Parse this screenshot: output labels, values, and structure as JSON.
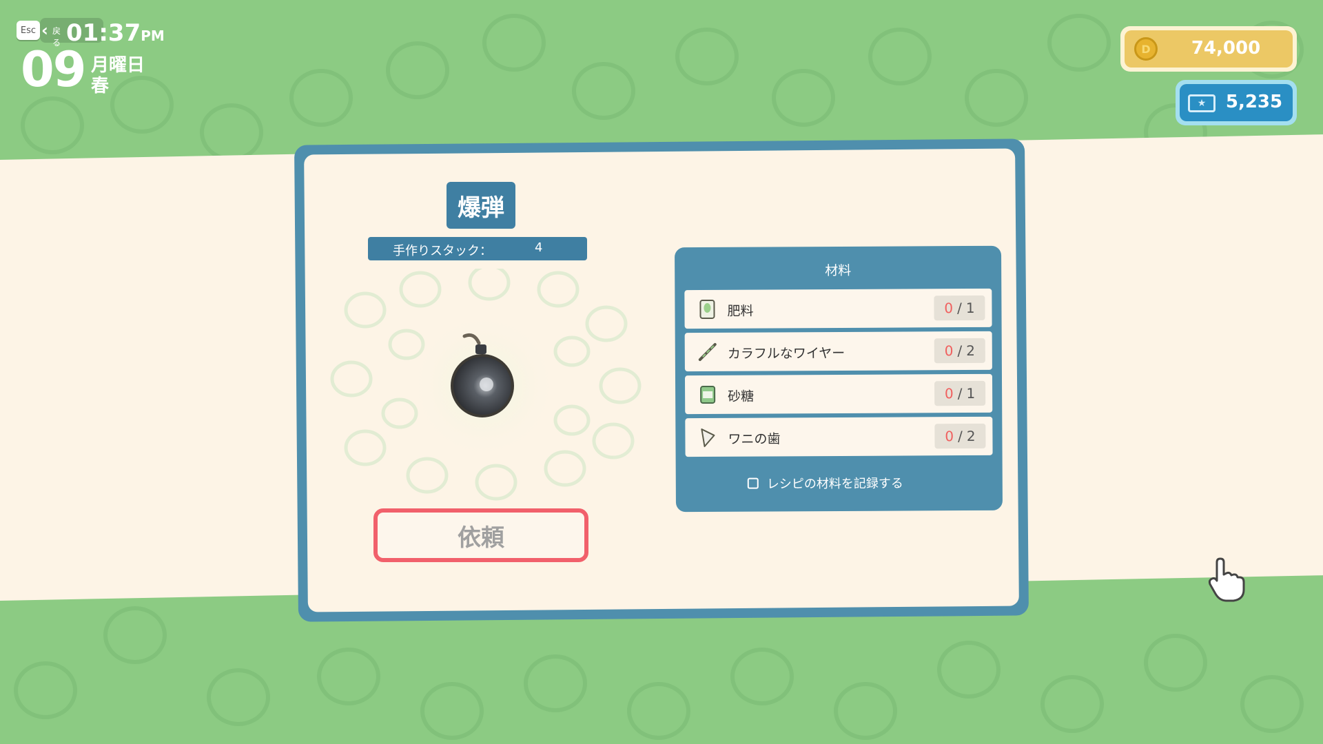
{
  "hud": {
    "esc_key": "Esc",
    "back_label": "戻る",
    "time": "01:37",
    "ampm": "PM",
    "day": "09",
    "weekday": "月曜日",
    "season": "春"
  },
  "currency": {
    "coins": "74,000",
    "coin_icon": "coin-icon",
    "tickets": "5,235",
    "ticket_icon": "ticket-icon"
  },
  "item": {
    "name": "爆弾",
    "stack_label": "手作りスタック：",
    "stack_value": "4",
    "illustration": "bomb-icon"
  },
  "request_button": "依頼",
  "materials": {
    "title": "材料",
    "items": [
      {
        "name": "肥料",
        "have": "0",
        "sep": "/",
        "need": "1",
        "icon": "fertilizer-bag-icon"
      },
      {
        "name": "カラフルなワイヤー",
        "have": "0",
        "sep": "/",
        "need": "2",
        "icon": "colorful-wire-icon"
      },
      {
        "name": "砂糖",
        "have": "0",
        "sep": "/",
        "need": "1",
        "icon": "sugar-bag-icon"
      },
      {
        "name": "ワニの歯",
        "have": "0",
        "sep": "/",
        "need": "2",
        "icon": "crocodile-tooth-icon"
      }
    ],
    "record_label": "レシピの材料を記録する"
  },
  "colors": {
    "background": "#8ccb83",
    "band": "#fdf4e6",
    "panel_border": "#4f8fad",
    "title_bg": "#3f7fa2",
    "request_border": "#f1606b",
    "count_have": "#f0605f",
    "coin_bg": "#ecc865",
    "ticket_bg": "#2a8fc4"
  }
}
